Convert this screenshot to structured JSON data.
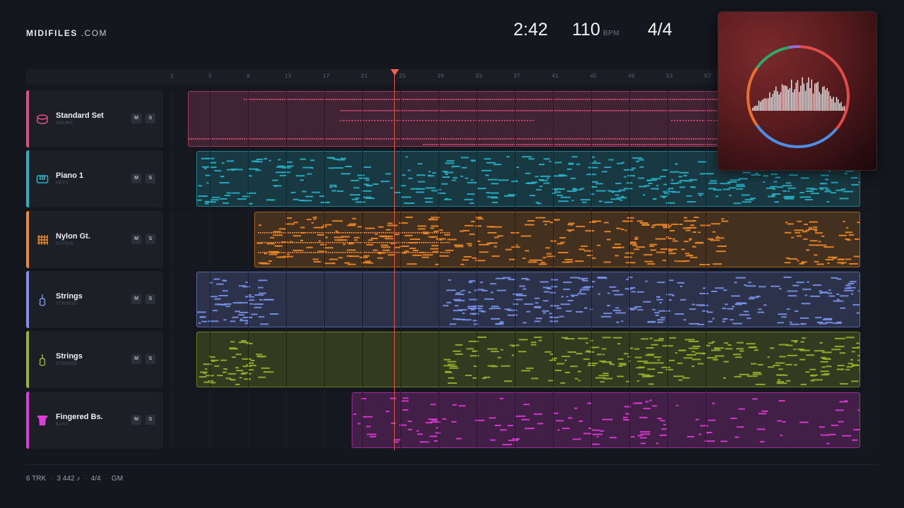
{
  "brand": {
    "name_bold": "MIDIFILES",
    "name_light": ".COM"
  },
  "transport": {
    "time": "2:42",
    "bpm": "110",
    "bpm_unit": "BPM",
    "signature": "4/4"
  },
  "ruler": {
    "ticks": [
      "1",
      "5",
      "9",
      "13",
      "17",
      "21",
      "25",
      "29",
      "33",
      "37",
      "41",
      "45",
      "49",
      "53",
      "57"
    ]
  },
  "playhead_bar": 25,
  "tracks": [
    {
      "name": "Standard Set",
      "category": "DRUMS",
      "icon": "drum-icon",
      "color": "#e0507f",
      "mute_label": "M",
      "solo_label": "S"
    },
    {
      "name": "Piano 1",
      "category": "KEYS",
      "icon": "piano-icon",
      "color": "#27b3c6",
      "mute_label": "M",
      "solo_label": "S"
    },
    {
      "name": "Nylon Gt.",
      "category": "GUITAR",
      "icon": "guitar-icon",
      "color": "#ef8a26",
      "mute_label": "M",
      "solo_label": "S"
    },
    {
      "name": "Strings",
      "category": "STRINGS",
      "icon": "violin-icon",
      "color": "#7b93ea",
      "mute_label": "M",
      "solo_label": "S"
    },
    {
      "name": "Strings",
      "category": "STRINGS",
      "icon": "violin-icon",
      "color": "#9ab52a",
      "mute_label": "M",
      "solo_label": "S"
    },
    {
      "name": "Fingered Bs.",
      "category": "BASS",
      "icon": "bass-amp-icon",
      "color": "#e03ad8",
      "mute_label": "M",
      "solo_label": "S"
    }
  ],
  "footer": {
    "tracks": "6 TRK",
    "notes": "3 442 ♪",
    "signature": "4/4",
    "standard": "GM"
  }
}
